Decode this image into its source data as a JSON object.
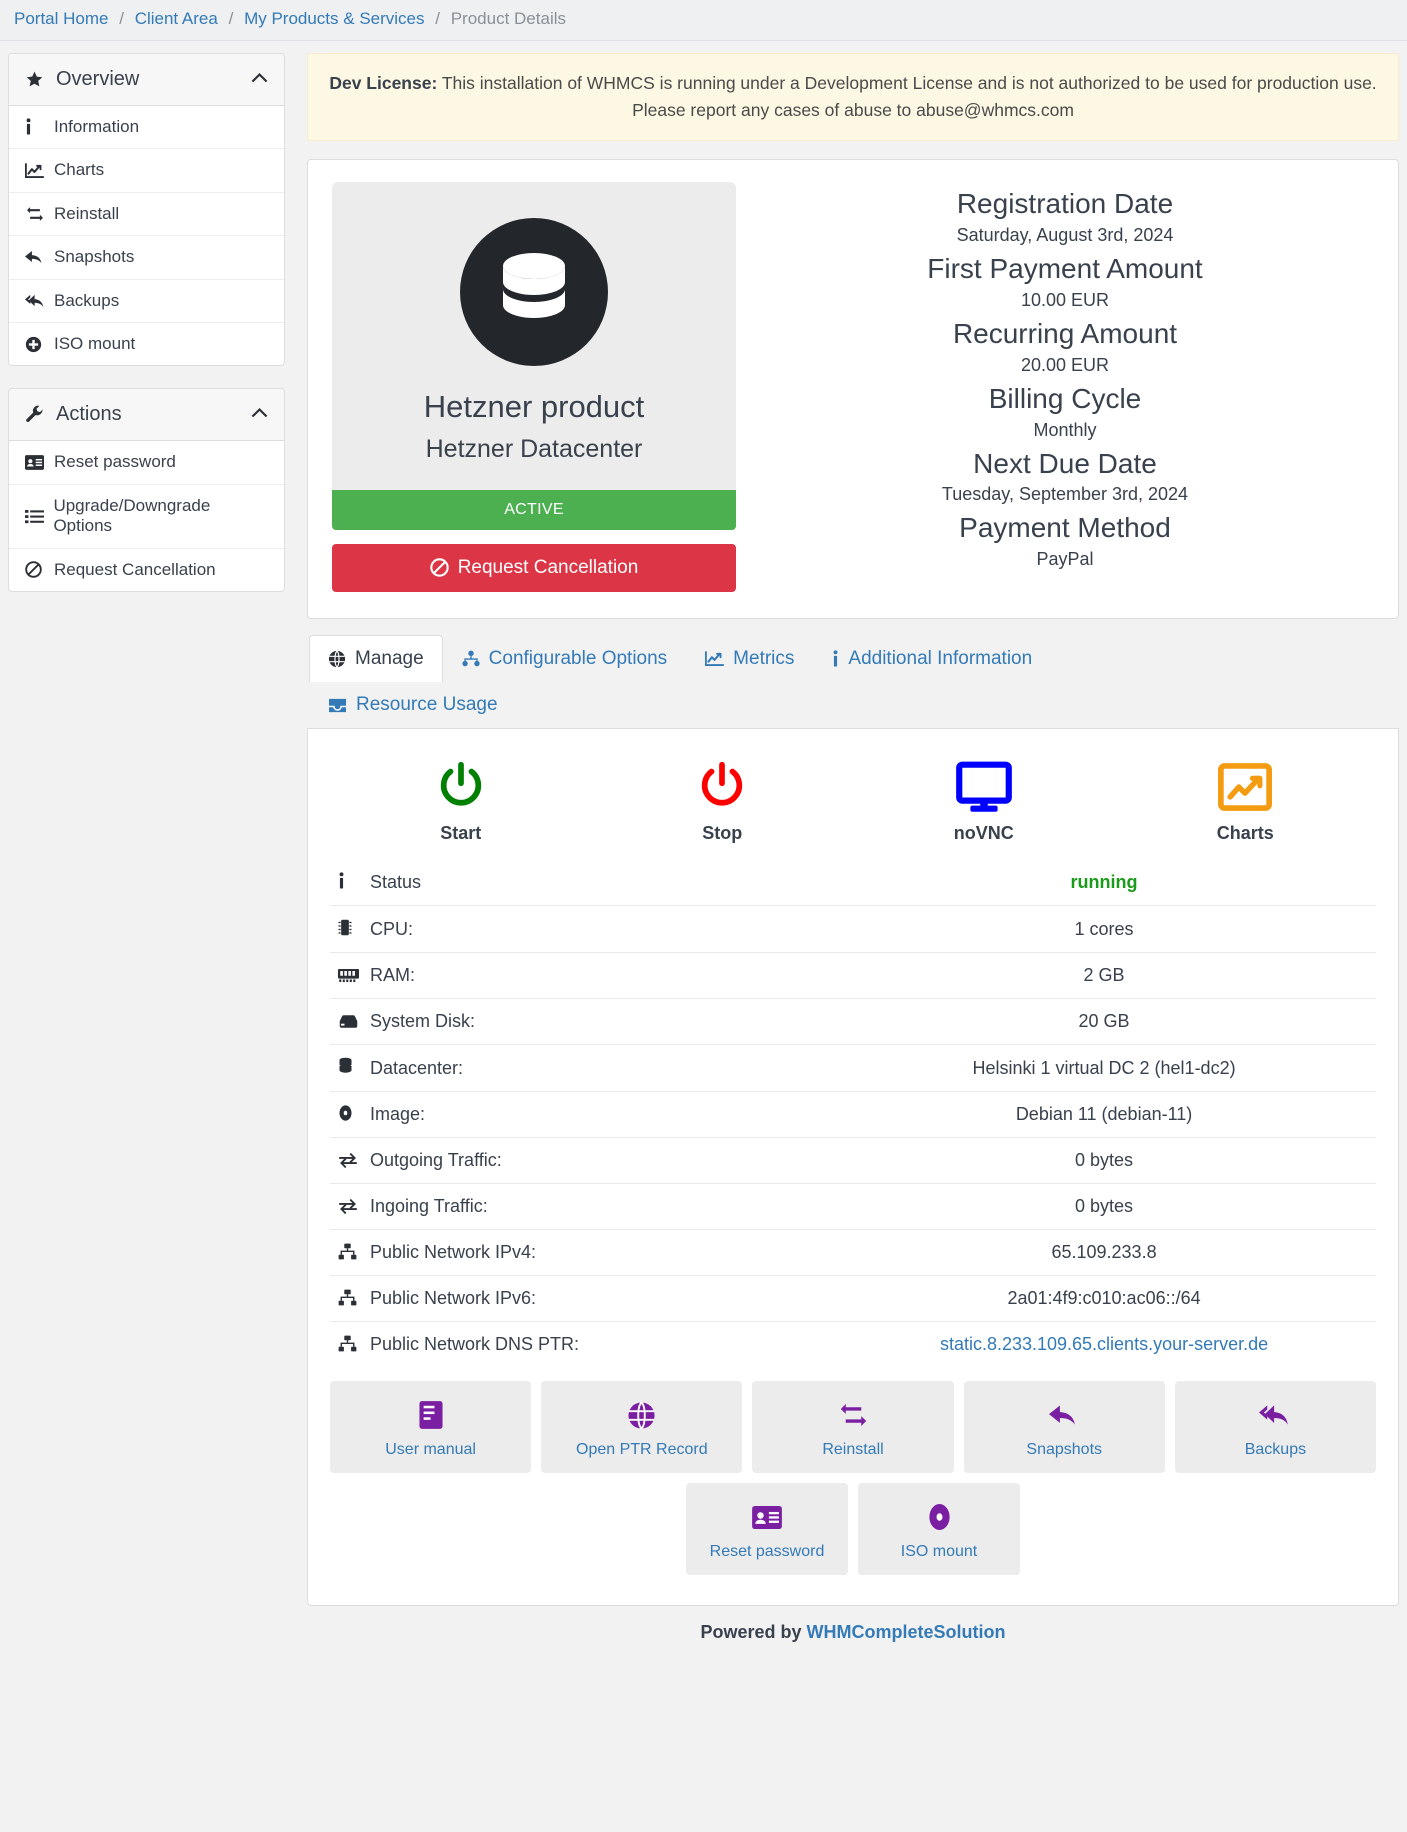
{
  "breadcrumb": {
    "items": [
      {
        "label": "Portal Home",
        "current": false
      },
      {
        "label": "Client Area",
        "current": false
      },
      {
        "label": "My Products & Services",
        "current": false
      },
      {
        "label": "Product Details",
        "current": true
      }
    ],
    "separator": "/"
  },
  "sidebar": {
    "panels": [
      {
        "title": "Overview",
        "icon": "star-icon",
        "caret": "chevron-up-icon",
        "items": [
          {
            "label": "Information",
            "icon": "info-icon"
          },
          {
            "label": "Charts",
            "icon": "chart-line-icon"
          },
          {
            "label": "Reinstall",
            "icon": "retweet-icon"
          },
          {
            "label": "Snapshots",
            "icon": "reply-icon"
          },
          {
            "label": "Backups",
            "icon": "reply-all-icon"
          },
          {
            "label": "ISO mount",
            "icon": "plus-circle-icon"
          }
        ]
      },
      {
        "title": "Actions",
        "icon": "wrench-icon",
        "caret": "chevron-up-icon",
        "items": [
          {
            "label": "Reset password",
            "icon": "id-card-icon"
          },
          {
            "label": "Upgrade/Downgrade Options",
            "icon": "list-icon"
          },
          {
            "label": "Request Cancellation",
            "icon": "ban-icon"
          }
        ]
      }
    ]
  },
  "alert": {
    "strong": "Dev License:",
    "text": " This installation of WHMCS is running under a Development License and is not authorized to be used for production use. Please report any cases of abuse to abuse@whmcs.com"
  },
  "product": {
    "logo_icon": "database-icon",
    "name": "Hetzner product",
    "group": "Hetzner Datacenter",
    "status": "ACTIVE",
    "status_color": "#4caf50",
    "cancel_button": "Request Cancellation",
    "cancel_icon": "ban-icon",
    "cancel_color": "#dc3545"
  },
  "billing": {
    "fields": [
      {
        "label": "Registration Date",
        "value": "Saturday, August 3rd, 2024"
      },
      {
        "label": "First Payment Amount",
        "value": "10.00 EUR"
      },
      {
        "label": "Recurring Amount",
        "value": "20.00 EUR"
      },
      {
        "label": "Billing Cycle",
        "value": "Monthly"
      },
      {
        "label": "Next Due Date",
        "value": "Tuesday, September 3rd, 2024"
      },
      {
        "label": "Payment Method",
        "value": "PayPal"
      }
    ]
  },
  "tabs": [
    {
      "label": "Manage",
      "icon": "globe-icon",
      "active": true
    },
    {
      "label": "Configurable Options",
      "icon": "sitemap-icon",
      "active": false
    },
    {
      "label": "Metrics",
      "icon": "chart-line-icon",
      "active": false
    },
    {
      "label": "Additional Information",
      "icon": "info-icon",
      "active": false
    },
    {
      "label": "Resource Usage",
      "icon": "inbox-icon",
      "active": false
    }
  ],
  "quick_actions": [
    {
      "label": "Start",
      "icon": "power-icon",
      "color": "#008000"
    },
    {
      "label": "Stop",
      "icon": "power-icon",
      "color": "#ff0000"
    },
    {
      "label": "noVNC",
      "icon": "desktop-icon",
      "color": "#0000ff"
    },
    {
      "label": "Charts",
      "icon": "chart-area-icon",
      "color": "#f39c12"
    }
  ],
  "info_rows": [
    {
      "key": "Status",
      "icon": "info-icon",
      "value": "running",
      "value_style": "running",
      "link": false
    },
    {
      "key": "CPU:",
      "icon": "microchip-icon",
      "value": "1 cores",
      "value_style": "",
      "link": false
    },
    {
      "key": "RAM:",
      "icon": "memory-icon",
      "value": "2 GB",
      "value_style": "",
      "link": false
    },
    {
      "key": "System Disk:",
      "icon": "hdd-icon",
      "value": "20 GB",
      "value_style": "",
      "link": false
    },
    {
      "key": "Datacenter:",
      "icon": "database-icon",
      "value": "Helsinki 1 virtual DC 2 (hel1-dc2)",
      "value_style": "",
      "link": false
    },
    {
      "key": "Image:",
      "icon": "compact-disc-icon",
      "value": "Debian 11 (debian-11)",
      "value_style": "",
      "link": false
    },
    {
      "key": "Outgoing Traffic:",
      "icon": "exchange-icon",
      "value": "0 bytes",
      "value_style": "",
      "link": false
    },
    {
      "key": "Ingoing Traffic:",
      "icon": "exchange-icon",
      "value": "0 bytes",
      "value_style": "",
      "link": false
    },
    {
      "key": "Public Network IPv4:",
      "icon": "network-icon",
      "value": "65.109.233.8",
      "value_style": "",
      "link": false
    },
    {
      "key": "Public Network IPv6:",
      "icon": "network-icon",
      "value": "2a01:4f9:c010:ac06::/64",
      "value_style": "",
      "link": false
    },
    {
      "key": "Public Network DNS PTR:",
      "icon": "network-icon",
      "value": "static.8.233.109.65.clients.your-server.de",
      "value_style": "",
      "link": true
    }
  ],
  "tiles_row1": [
    {
      "label": "User manual",
      "icon": "book-icon"
    },
    {
      "label": "Open PTR Record",
      "icon": "globe-icon"
    },
    {
      "label": "Reinstall",
      "icon": "retweet-icon"
    },
    {
      "label": "Snapshots",
      "icon": "reply-icon"
    },
    {
      "label": "Backups",
      "icon": "reply-all-icon"
    }
  ],
  "tiles_row2": [
    {
      "label": "Reset password",
      "icon": "id-card-icon"
    },
    {
      "label": "ISO mount",
      "icon": "compact-disc-icon"
    }
  ],
  "footer": {
    "prefix": "Powered by ",
    "link": "WHMCompleteSolution"
  }
}
